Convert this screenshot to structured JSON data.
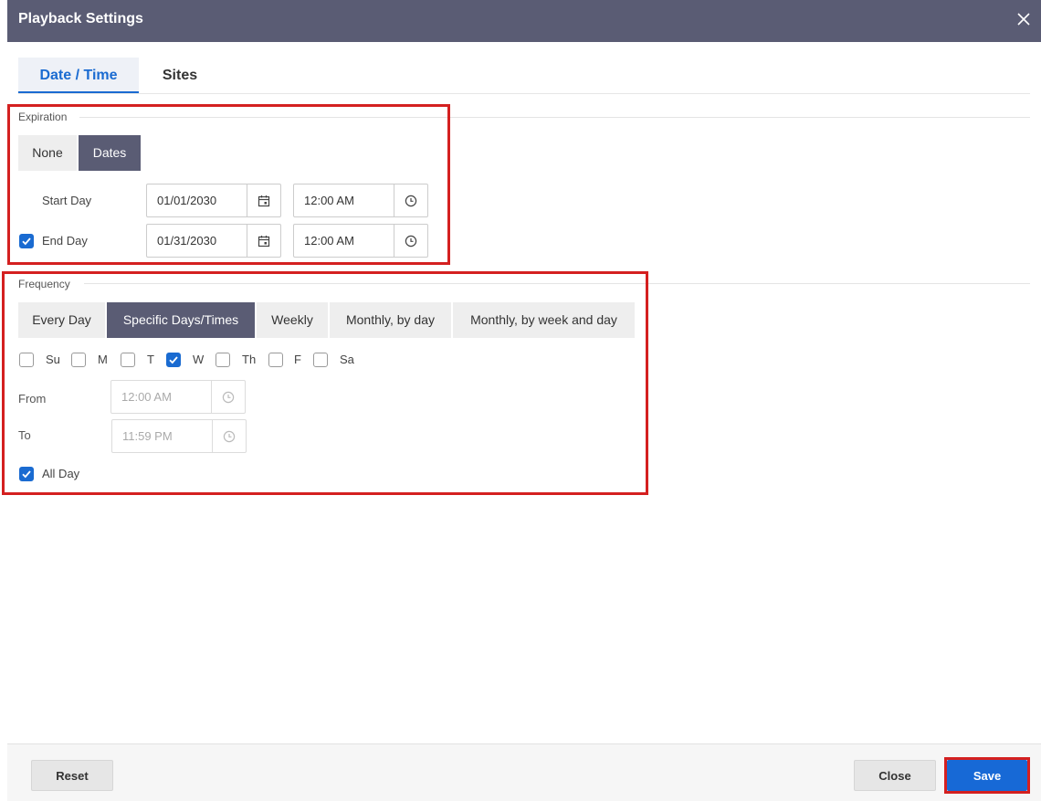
{
  "dialog": {
    "title": "Playback Settings"
  },
  "tabs": [
    {
      "label": "Date / Time",
      "active": true
    },
    {
      "label": "Sites",
      "active": false
    }
  ],
  "expiration": {
    "legend": "Expiration",
    "options": [
      {
        "label": "None",
        "selected": false
      },
      {
        "label": "Dates",
        "selected": true
      }
    ],
    "start": {
      "label": "Start Day",
      "date": "01/01/2030",
      "time": "12:00 AM"
    },
    "end": {
      "label": "End Day",
      "checked": true,
      "date": "01/31/2030",
      "time": "12:00 AM"
    }
  },
  "frequency": {
    "legend": "Frequency",
    "options": [
      {
        "label": "Every Day",
        "selected": false
      },
      {
        "label": "Specific Days/Times",
        "selected": true
      },
      {
        "label": "Weekly",
        "selected": false
      },
      {
        "label": "Monthly, by day",
        "selected": false
      },
      {
        "label": "Monthly, by week and day",
        "selected": false
      }
    ],
    "days": [
      {
        "label": "Su",
        "checked": false
      },
      {
        "label": "M",
        "checked": false
      },
      {
        "label": "T",
        "checked": false
      },
      {
        "label": "W",
        "checked": true
      },
      {
        "label": "Th",
        "checked": false
      },
      {
        "label": "F",
        "checked": false
      },
      {
        "label": "Sa",
        "checked": false
      }
    ],
    "from": {
      "label": "From",
      "time": "12:00 AM",
      "disabled": true
    },
    "to": {
      "label": "To",
      "time": "11:59 PM",
      "disabled": true
    },
    "all_day": {
      "label": "All Day",
      "checked": true
    }
  },
  "footer": {
    "reset_label": "Reset",
    "close_label": "Close",
    "save_label": "Save"
  },
  "colors": {
    "header": "#5a5c74",
    "accent": "#1769d6",
    "highlight": "#d42020"
  },
  "icons": {
    "close": "close-icon",
    "calendar": "calendar-icon",
    "clock": "clock-icon",
    "check": "checkmark-icon"
  }
}
